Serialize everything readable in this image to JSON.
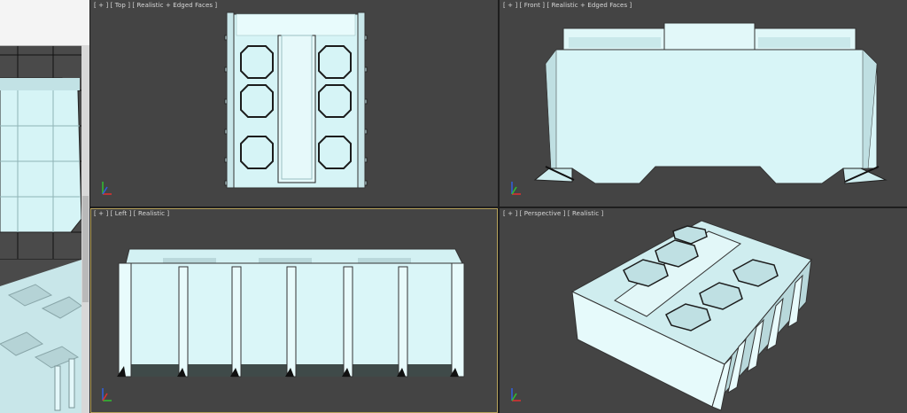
{
  "viewports": {
    "top": {
      "label": "[ + ] [ Top ] [ Realistic + Edged Faces ]"
    },
    "front": {
      "label": "[ + ] [ Front ] [ Realistic + Edged Faces ]"
    },
    "left": {
      "label": "[ + ] [ Left ] [ Realistic ]"
    },
    "perspective": {
      "label": "[ + ] [ Perspective ] [ Realistic ]"
    }
  },
  "colors": {
    "viewport_bg": "#444444",
    "model_fill": "#d6f4f6",
    "model_shade": "#a9c9cc",
    "active_border": "#b8a35c"
  }
}
